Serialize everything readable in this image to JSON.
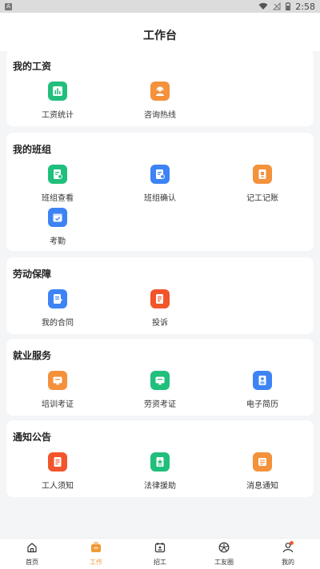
{
  "status": {
    "time": "2:58"
  },
  "header": {
    "title": "工作台"
  },
  "colors": {
    "green": "#20bf7c",
    "orange": "#f4913b",
    "blue": "#3d83f5",
    "red": "#f2552c",
    "accent": "#f29b38"
  },
  "sections": [
    {
      "title": "我的工资",
      "items": [
        {
          "label": "工资统计",
          "icon": "bar-chart-icon",
          "color": "#20bf7c"
        },
        {
          "label": "咨询热线",
          "icon": "headset-icon",
          "color": "#f4913b"
        }
      ]
    },
    {
      "title": "我的班组",
      "items": [
        {
          "label": "班组查看",
          "icon": "document-search-icon",
          "color": "#20bf7c"
        },
        {
          "label": "班组确认",
          "icon": "document-check-icon",
          "color": "#3d83f5"
        },
        {
          "label": "记工记账",
          "icon": "notebook-icon",
          "color": "#f4913b"
        },
        {
          "label": "考勤",
          "icon": "calendar-check-icon",
          "color": "#3d83f5"
        }
      ]
    },
    {
      "title": "劳动保障",
      "items": [
        {
          "label": "我的合同",
          "icon": "contract-icon",
          "color": "#3d83f5"
        },
        {
          "label": "投诉",
          "icon": "complaint-icon",
          "color": "#f2552c"
        }
      ]
    },
    {
      "title": "就业服务",
      "items": [
        {
          "label": "培训考证",
          "icon": "certificate-icon",
          "color": "#f4913b"
        },
        {
          "label": "劳资考证",
          "icon": "certificate-icon",
          "color": "#20bf7c"
        },
        {
          "label": "电子简历",
          "icon": "resume-icon",
          "color": "#3d83f5"
        }
      ]
    },
    {
      "title": "通知公告",
      "items": [
        {
          "label": "工人须知",
          "icon": "notice-icon",
          "color": "#f2552c"
        },
        {
          "label": "法律援助",
          "icon": "legal-aid-icon",
          "color": "#20bf7c"
        },
        {
          "label": "消息通知",
          "icon": "message-icon",
          "color": "#f4913b"
        }
      ]
    }
  ],
  "tabbar": [
    {
      "label": "首页",
      "icon": "home-icon"
    },
    {
      "label": "工作",
      "icon": "work-icon",
      "active": true
    },
    {
      "label": "招工",
      "icon": "recruit-icon"
    },
    {
      "label": "工友圈",
      "icon": "friends-circle-icon"
    },
    {
      "label": "我的",
      "icon": "profile-icon"
    }
  ]
}
